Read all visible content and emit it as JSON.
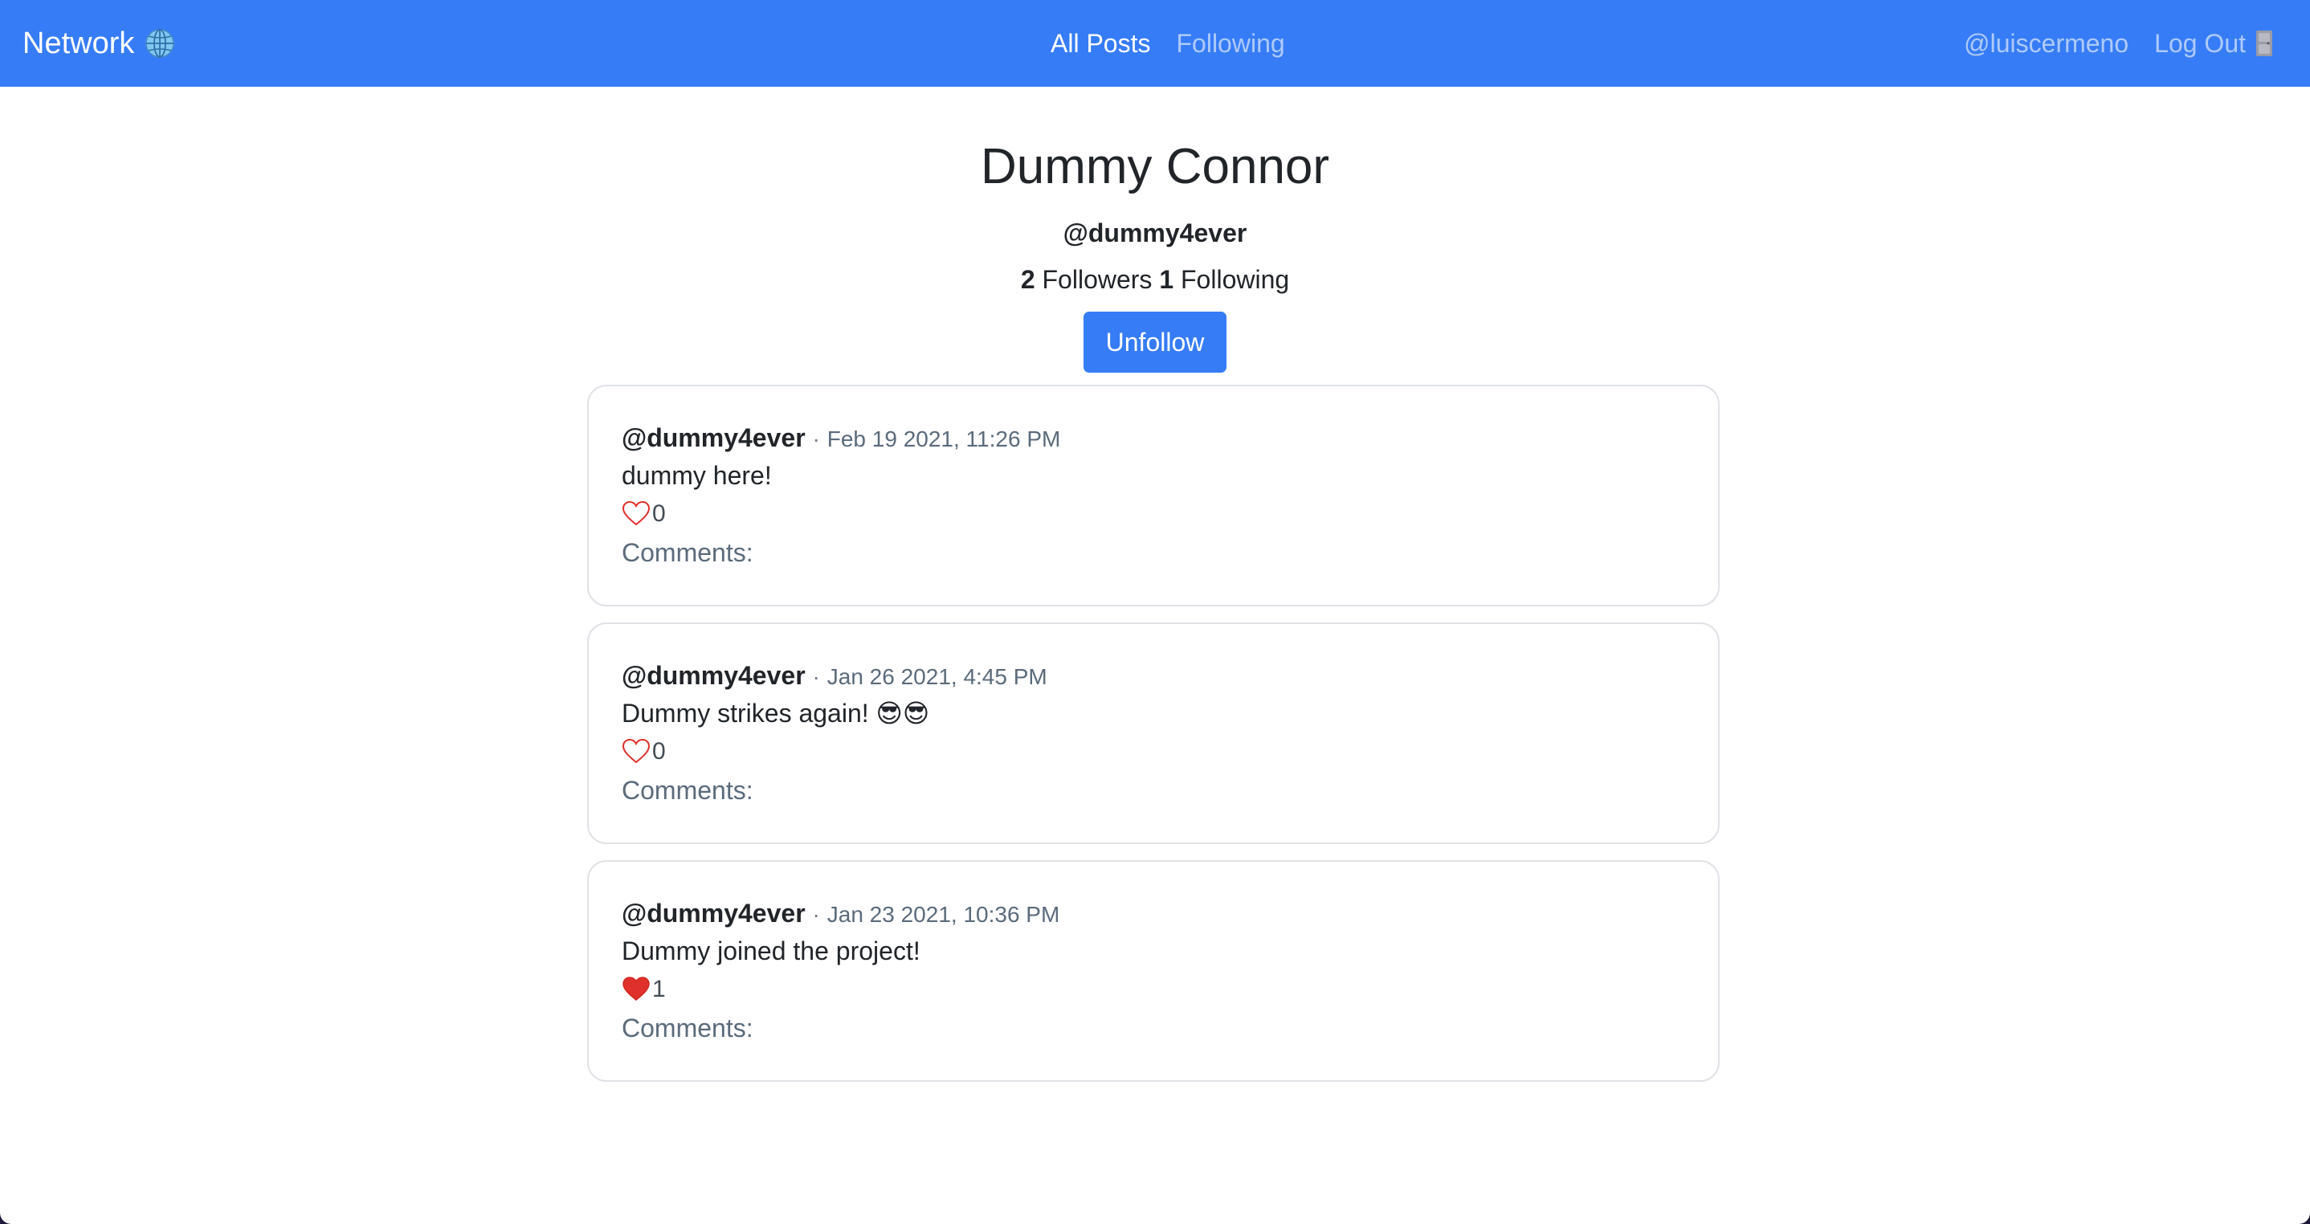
{
  "navbar": {
    "brand": "Network",
    "brand_icon": "globe-icon",
    "links": {
      "all_posts": "All Posts",
      "following": "Following"
    },
    "user": "@luiscermeno",
    "logout": "Log Out",
    "logout_icon": "door-icon",
    "color": "#367cf6"
  },
  "profile": {
    "name": "Dummy Connor",
    "handle": "@dummy4ever",
    "followers_count": "2",
    "followers_label": "Followers",
    "following_count": "1",
    "following_label": "Following",
    "unfollow_label": "Unfollow"
  },
  "posts": [
    {
      "author": "@dummy4ever",
      "separator": "·",
      "date": "Feb 19 2021, 11:26 PM",
      "body": "dummy here!",
      "liked": false,
      "likes": "0",
      "comments_label": "Comments:"
    },
    {
      "author": "@dummy4ever",
      "separator": "·",
      "date": "Jan 26 2021, 4:45 PM",
      "body": "Dummy strikes again! 😎😎",
      "liked": false,
      "likes": "0",
      "comments_label": "Comments:"
    },
    {
      "author": "@dummy4ever",
      "separator": "·",
      "date": "Jan 23 2021, 10:36 PM",
      "body": "Dummy joined the project!",
      "liked": true,
      "likes": "1",
      "comments_label": "Comments:"
    }
  ]
}
